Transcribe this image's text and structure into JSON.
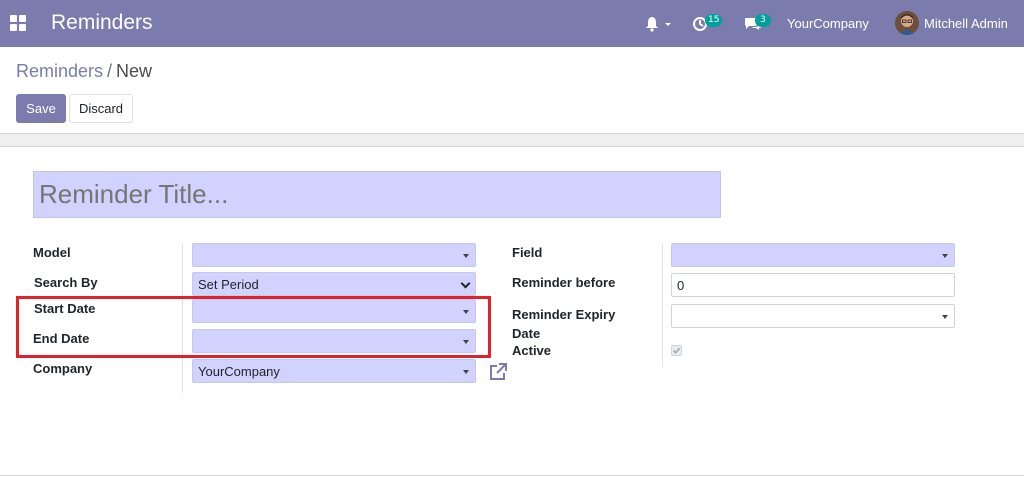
{
  "navbar": {
    "app_title": "Reminders",
    "activity_count": "15",
    "message_count": "3",
    "company": "YourCompany",
    "user": "Mitchell Admin",
    "color": "#7c7bad"
  },
  "breadcrumb": {
    "parent": "Reminders",
    "separator": "/",
    "current": "New"
  },
  "buttons": {
    "save": "Save",
    "discard": "Discard"
  },
  "form": {
    "title_placeholder": "Reminder Title...",
    "left": {
      "model_label": "Model",
      "model_value": "",
      "search_by_label": "Search By",
      "search_by_value": "Set Period",
      "start_date_label": "Start Date",
      "start_date_value": "",
      "end_date_label": "End Date",
      "end_date_value": "",
      "company_label": "Company",
      "company_value": "YourCompany"
    },
    "right": {
      "field_label": "Field",
      "field_value": "",
      "reminder_before_label": "Reminder before",
      "reminder_before_value": "0",
      "expiry_label_line1": "Reminder Expiry",
      "expiry_label_line2": "Date",
      "expiry_value": "",
      "active_label": "Active",
      "active_checked": true
    }
  },
  "colors": {
    "required_field": "#d2d2ff",
    "highlight": "#e0232b"
  }
}
